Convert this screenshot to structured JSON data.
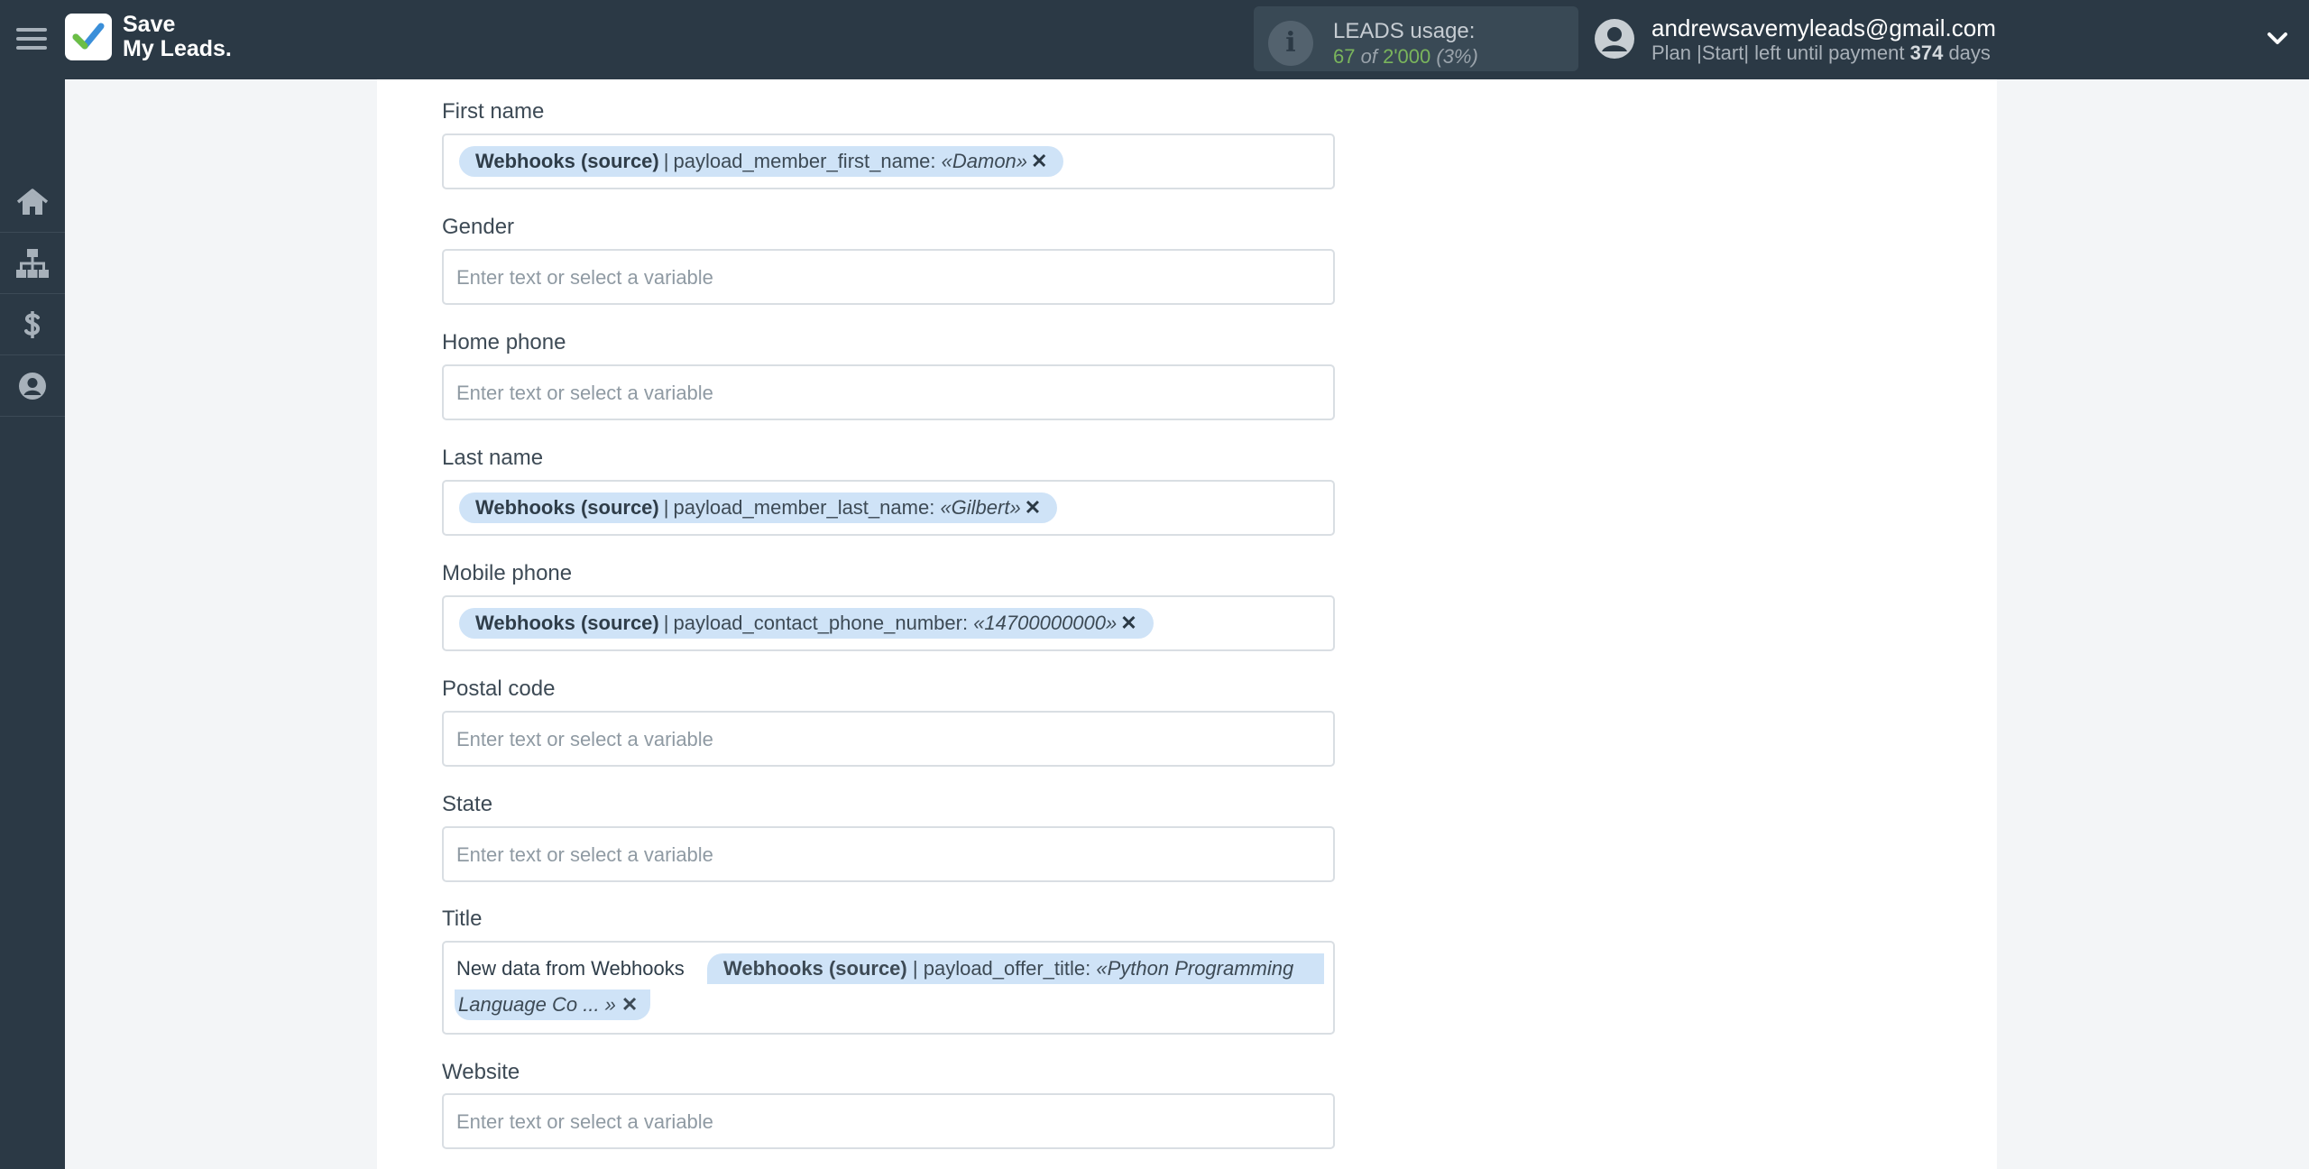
{
  "header": {
    "logo_line1": "Save",
    "logo_line2": "My Leads.",
    "usage": {
      "title": "LEADS usage:",
      "used": "67",
      "of_text": "of",
      "limit": "2'000",
      "percent": "(3%)"
    },
    "user": {
      "email": "andrewsavemyleads@gmail.com",
      "plan_prefix": "Plan |Start| left until payment",
      "days": "374",
      "days_suffix": "days"
    }
  },
  "sidebar": {
    "items": [
      {
        "icon": "home-icon"
      },
      {
        "icon": "sitemap-icon"
      },
      {
        "icon": "dollar-icon"
      },
      {
        "icon": "user-circle-icon"
      }
    ]
  },
  "fields": [
    {
      "label": "First name",
      "chip": {
        "source": "Webhooks (source)",
        "sep": "|",
        "name": "payload_member_first_name:",
        "value": "«Damon»"
      }
    },
    {
      "label": "Gender",
      "placeholder": "Enter text or select a variable"
    },
    {
      "label": "Home phone",
      "placeholder": "Enter text or select a variable"
    },
    {
      "label": "Last name",
      "chip": {
        "source": "Webhooks (source)",
        "sep": "|",
        "name": "payload_member_last_name:",
        "value": "«Gilbert»"
      }
    },
    {
      "label": "Mobile phone",
      "chip": {
        "source": "Webhooks (source)",
        "sep": "|",
        "name": "payload_contact_phone_number:",
        "value": "«14700000000»"
      }
    },
    {
      "label": "Postal code",
      "placeholder": "Enter text or select a variable"
    },
    {
      "label": "State",
      "placeholder": "Enter text or select a variable"
    },
    {
      "label": "Title",
      "static_text": "New data from Webhooks",
      "chip": {
        "source": "Webhooks (source)",
        "sep": "|",
        "name": "payload_offer_title:",
        "value_line1": "«Python Programming",
        "value_line2": "Language Co ... »"
      }
    },
    {
      "label": "Website",
      "placeholder": "Enter text or select a variable"
    }
  ],
  "colors": {
    "topbar": "#2b3945",
    "chip": "#cfe3f7",
    "usage_accent": "#7ab55c"
  }
}
